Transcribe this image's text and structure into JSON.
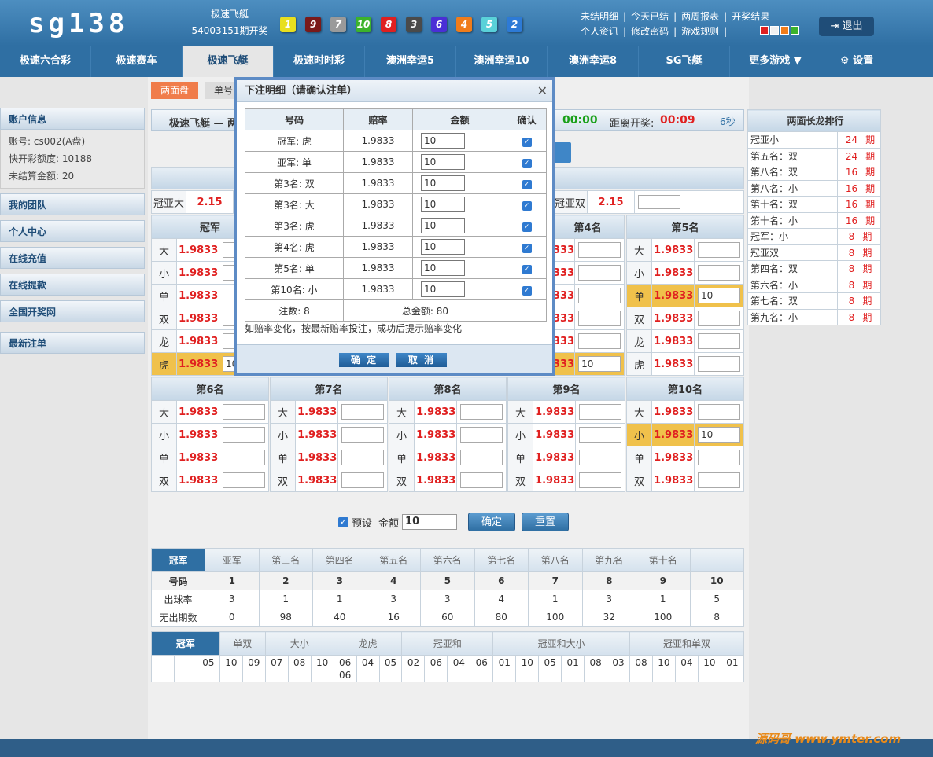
{
  "header": {
    "logo": "sg138",
    "lottery_name": "极速飞艇",
    "issue": "54003151期开奖",
    "balls": [
      {
        "n": "1",
        "color": "#e8df1e"
      },
      {
        "n": "9",
        "color": "#7a1a1a"
      },
      {
        "n": "7",
        "color": "#9a9a9a"
      },
      {
        "n": "10",
        "color": "#3cb32b"
      },
      {
        "n": "8",
        "color": "#e02020"
      },
      {
        "n": "3",
        "color": "#4a4a4a"
      },
      {
        "n": "6",
        "color": "#4a2fd6"
      },
      {
        "n": "4",
        "color": "#f07c1a"
      },
      {
        "n": "5",
        "color": "#5ad1d9"
      },
      {
        "n": "2",
        "color": "#2d7ad6"
      }
    ],
    "links_row1": [
      "未结明细",
      "今天已结",
      "两周报表",
      "开奖结果"
    ],
    "links_row2": [
      "个人资讯",
      "修改密码",
      "游戏规则"
    ],
    "separator": "|",
    "swatch_colors": [
      "#e02020",
      "#f0f0f0",
      "#f07c1a",
      "#3cb32b"
    ],
    "logout": "退出"
  },
  "nav": {
    "items": [
      "极速六合彩",
      "极速赛车",
      "极速飞艇",
      "极速时时彩",
      "澳洲幸运5",
      "澳洲幸运10",
      "澳洲幸运8",
      "SG飞艇",
      "更多游戏 ▼"
    ],
    "active_index": 2,
    "settings": "设置"
  },
  "sidebar": {
    "account_title": "账户信息",
    "account_rows": [
      "账号:   cs002(A盘)",
      "快开彩额度:   10188",
      "未结算金额:   20"
    ],
    "links": [
      "我的团队",
      "个人中心",
      "在线充值",
      "在线提款",
      "全国开奖网",
      "最新注单"
    ]
  },
  "subtabs": [
    "两面盘",
    "单号"
  ],
  "info_bar": {
    "left": "极速飞艇 — 两",
    "time1": "00:00",
    "draw_label": "距离开奖:",
    "draw_time": "00:09",
    "seconds": "6秒"
  },
  "combo_row": {
    "label1": "冠亚大",
    "odds1": "2.15",
    "label2": "冠亚双",
    "odds2": "2.15"
  },
  "grid_top": {
    "headers": [
      "冠军",
      "第4名",
      "第5名"
    ],
    "col1": [
      {
        "label": "大",
        "odds": "1.9833",
        "value": ""
      },
      {
        "label": "小",
        "odds": "1.9833",
        "value": ""
      },
      {
        "label": "单",
        "odds": "1.9833",
        "value": ""
      },
      {
        "label": "双",
        "odds": "1.9833",
        "value": ""
      },
      {
        "label": "龙",
        "odds": "1.9833",
        "value": ""
      },
      {
        "label": "虎",
        "odds": "1.9833",
        "value": "10"
      }
    ],
    "col4_odds": [
      "333",
      "333",
      "333",
      "333",
      "333",
      "333"
    ],
    "col4_values": [
      "",
      "",
      "",
      "",
      "",
      "10"
    ],
    "col5": [
      {
        "label": "大",
        "odds": "1.9833",
        "value": ""
      },
      {
        "label": "小",
        "odds": "1.9833",
        "value": ""
      },
      {
        "label": "单",
        "odds": "1.9833",
        "value": "10"
      },
      {
        "label": "双",
        "odds": "1.9833",
        "value": ""
      },
      {
        "label": "龙",
        "odds": "1.9833",
        "value": ""
      },
      {
        "label": "虎",
        "odds": "1.9833",
        "value": ""
      }
    ]
  },
  "grid_bottom": {
    "headers": [
      "第6名",
      "第7名",
      "第8名",
      "第9名",
      "第10名"
    ],
    "labels": [
      "大",
      "小",
      "单",
      "双"
    ],
    "odds": "1.9833",
    "selected": {
      "col": 4,
      "row": 1,
      "value": "10"
    }
  },
  "preset": {
    "label": "预设",
    "amount_label": "金额",
    "amount": "10",
    "confirm": "确定",
    "reset": "重置"
  },
  "stats": {
    "tabs": [
      "冠军",
      "亚军",
      "第三名",
      "第四名",
      "第五名",
      "第六名",
      "第七名",
      "第八名",
      "第九名",
      "第十名"
    ],
    "num_header": "号码",
    "numbers": [
      "1",
      "2",
      "3",
      "4",
      "5",
      "6",
      "7",
      "8",
      "9",
      "10"
    ],
    "rate_label": "出球率",
    "rates": [
      "3",
      "1",
      "1",
      "3",
      "3",
      "4",
      "1",
      "3",
      "1",
      "5"
    ],
    "miss_label": "无出期数",
    "misses": [
      "0",
      "98",
      "40",
      "16",
      "60",
      "80",
      "100",
      "32",
      "100",
      "8"
    ]
  },
  "stats2": {
    "tabs": [
      "冠军",
      "单双",
      "大小",
      "龙虎",
      "冠亚和",
      "冠亚和大小",
      "冠亚和单双"
    ],
    "values": [
      "",
      "",
      "05",
      "10",
      "09",
      "07",
      "08",
      "10",
      "06 06",
      "04",
      "05",
      "02",
      "06",
      "04",
      "06",
      "01",
      "10",
      "05",
      "01",
      "08",
      "03",
      "08",
      "10",
      "04",
      "10",
      "01"
    ]
  },
  "ranking": {
    "title": "两面长龙排行",
    "unit": "期",
    "rows": [
      {
        "name": "冠亚小",
        "count": "24"
      },
      {
        "name": "第五名：双",
        "count": "24"
      },
      {
        "name": "第八名：双",
        "count": "16"
      },
      {
        "name": "第八名：小",
        "count": "16"
      },
      {
        "name": "第十名：双",
        "count": "16"
      },
      {
        "name": "第十名：小",
        "count": "16"
      },
      {
        "name": "冠军：小",
        "count": "8"
      },
      {
        "name": "冠亚双",
        "count": "8"
      },
      {
        "name": "第四名：双",
        "count": "8"
      },
      {
        "name": "第六名：小",
        "count": "8"
      },
      {
        "name": "第七名：双",
        "count": "8"
      },
      {
        "name": "第九名：小",
        "count": "8"
      }
    ]
  },
  "modal": {
    "title": "下注明细（请确认注单）",
    "close": "✕",
    "headers": [
      "号码",
      "赔率",
      "金额",
      "确认"
    ],
    "rows": [
      {
        "item": "冠军: 虎",
        "odds": "1.9833",
        "amount": "10"
      },
      {
        "item": "亚军: 单",
        "odds": "1.9833",
        "amount": "10"
      },
      {
        "item": "第3名: 双",
        "odds": "1.9833",
        "amount": "10"
      },
      {
        "item": "第3名: 大",
        "odds": "1.9833",
        "amount": "10"
      },
      {
        "item": "第3名: 虎",
        "odds": "1.9833",
        "amount": "10"
      },
      {
        "item": "第4名: 虎",
        "odds": "1.9833",
        "amount": "10"
      },
      {
        "item": "第5名: 单",
        "odds": "1.9833",
        "amount": "10"
      },
      {
        "item": "第10名: 小",
        "odds": "1.9833",
        "amount": "10"
      }
    ],
    "count_label": "注数: 8",
    "total_label": "总金额: 80",
    "note": "如赔率变化，按最新赔率投注，成功后提示赔率变化",
    "confirm": "确 定",
    "cancel": "取 消"
  },
  "watermark": "源码哥 www.ymter.com"
}
